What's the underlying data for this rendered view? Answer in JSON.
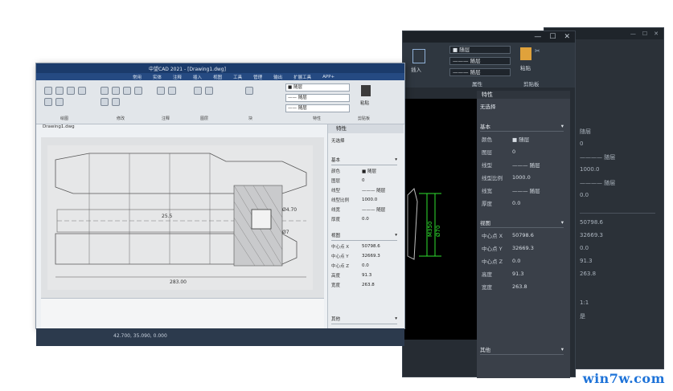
{
  "back_window": {
    "controls": [
      "—",
      "☐",
      "✕"
    ],
    "rows": [
      {
        "label": "随层"
      },
      {
        "label": "0"
      },
      {
        "label": "———— 随层"
      },
      {
        "label": "1000.0"
      },
      {
        "label": "———— 随层"
      },
      {
        "label": "0.0"
      },
      {
        "label": "50798.6"
      },
      {
        "label": "32669.3"
      },
      {
        "label": "0.0"
      },
      {
        "label": "91.3"
      },
      {
        "label": "263.8"
      },
      {
        "label": "1:1"
      },
      {
        "label": "是"
      }
    ]
  },
  "mid_window": {
    "controls": [
      "—",
      "☐",
      "✕"
    ],
    "ribbon": {
      "insert_label": "插入",
      "paste_label": "粘贴",
      "layer_combo": "■ 随层",
      "linetype_combo": "——— 随层",
      "lineweight_combo": "——— 随层",
      "panel_properties": "属性",
      "panel_clipboard": "剪贴板"
    },
    "properties": {
      "title": "特性",
      "selection": "无选择",
      "sections": {
        "basic": "基本",
        "view": "视图",
        "other": "其他"
      },
      "basic": [
        {
          "k": "颜色",
          "v": "■ 随层"
        },
        {
          "k": "图层",
          "v": "0"
        },
        {
          "k": "线型",
          "v": "——— 随层"
        },
        {
          "k": "线型比例",
          "v": "1000.0"
        },
        {
          "k": "线宽",
          "v": "——— 随层"
        },
        {
          "k": "厚度",
          "v": "0.0"
        }
      ],
      "view": [
        {
          "k": "中心点 X",
          "v": "50798.6"
        },
        {
          "k": "中心点 Y",
          "v": "32669.3"
        },
        {
          "k": "中心点 Z",
          "v": "0.0"
        },
        {
          "k": "高度",
          "v": "91.3"
        },
        {
          "k": "宽度",
          "v": "263.8"
        }
      ]
    },
    "dims": [
      "M350",
      "Ø70"
    ]
  },
  "front_window": {
    "title": "中望CAD 2021 - [Drawing1.dwg]",
    "menu": [
      "常用",
      "实体",
      "注释",
      "插入",
      "视图",
      "工具",
      "管理",
      "输出",
      "扩展工具",
      "APP+"
    ],
    "ribbon": {
      "layer_combo": "■ 随层",
      "linetype_combo": "—— 随层",
      "lineweight_combo": "—— 随层",
      "paste_label": "粘贴",
      "panel_labels": [
        "绘图",
        "修改",
        "注释",
        "图层",
        "块",
        "特性",
        "剪贴板"
      ]
    },
    "tab_label": "Drawing1.dwg",
    "properties": {
      "title": "特性",
      "selection": "无选择",
      "sections": {
        "basic": "基本",
        "view": "视图",
        "other": "其他"
      },
      "basic": [
        {
          "k": "颜色",
          "v": "■ 随层"
        },
        {
          "k": "图层",
          "v": "0"
        },
        {
          "k": "线型",
          "v": "——— 随层"
        },
        {
          "k": "线型比例",
          "v": "1000.0"
        },
        {
          "k": "线宽",
          "v": "——— 随层"
        },
        {
          "k": "厚度",
          "v": "0.0"
        }
      ],
      "view": [
        {
          "k": "中心点 X",
          "v": "50798.6"
        },
        {
          "k": "中心点 Y",
          "v": "32669.3"
        },
        {
          "k": "中心点 Z",
          "v": "0.0"
        },
        {
          "k": "高度",
          "v": "91.3"
        },
        {
          "k": "宽度",
          "v": "263.8"
        }
      ]
    },
    "drawing_dims": [
      "283.00",
      "Ø4.70",
      "Ø7",
      "25.5"
    ],
    "status_coords": "42.700, 35.090, 0.000"
  },
  "watermark": "win7w.com",
  "colors": {
    "accent": "#1e73d8",
    "dark_bg": "#262c33",
    "dim_green": "#2fe02f"
  }
}
